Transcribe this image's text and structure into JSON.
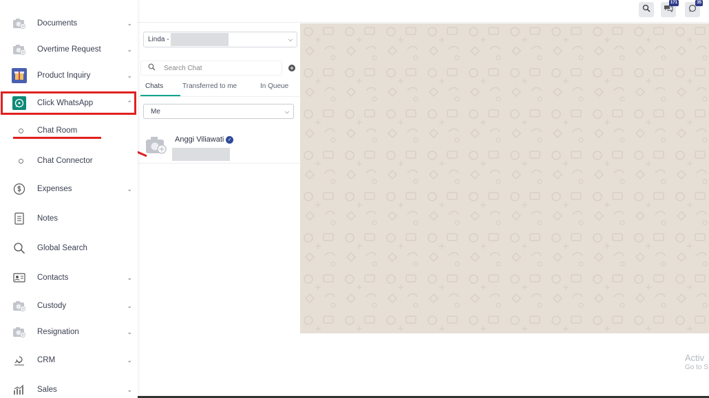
{
  "sidebar": {
    "items": [
      {
        "label": "Documents",
        "icon": "camera-placeholder-icon",
        "chevron": "down"
      },
      {
        "label": "Overtime Request",
        "icon": "camera-placeholder-icon",
        "chevron": "down"
      },
      {
        "label": "Product Inquiry",
        "icon": "product-inquiry-icon",
        "chevron": "down"
      },
      {
        "label": "Click WhatsApp",
        "icon": "whatsapp-icon",
        "chevron": "up"
      },
      {
        "label": "Chat Room",
        "icon": "circle-bullet-icon"
      },
      {
        "label": "Chat Connector",
        "icon": "circle-bullet-icon"
      },
      {
        "label": "Expenses",
        "icon": "money-icon",
        "chevron": "down"
      },
      {
        "label": "Notes",
        "icon": "notes-icon"
      },
      {
        "label": "Global Search",
        "icon": "search-icon"
      },
      {
        "label": "Contacts",
        "icon": "contacts-card-icon",
        "chevron": "down"
      },
      {
        "label": "Custody",
        "icon": "camera-placeholder-icon",
        "chevron": "down"
      },
      {
        "label": "Resignation",
        "icon": "camera-placeholder-icon",
        "chevron": "down"
      },
      {
        "label": "CRM",
        "icon": "crm-icon",
        "chevron": "down"
      },
      {
        "label": "Sales",
        "icon": "sales-chart-icon",
        "chevron": "down"
      }
    ]
  },
  "topbar": {
    "chat_badge": "171",
    "whatsapp_badge": "35"
  },
  "chat": {
    "agent_value": "Linda -",
    "search_placeholder": "Search Chat",
    "tabs": [
      "Chats",
      "Transferred to me",
      "In Queue"
    ],
    "filter_value": "Me",
    "contact_name": "Anggi Viliawati"
  },
  "watermark": {
    "line1": "Activ",
    "line2": "Go to S"
  },
  "colors": {
    "highlight": "#e02020",
    "whatsapp_green": "#0f8a76",
    "tab_active": "#0fa58c",
    "badge": "#2e3a8c",
    "wallpaper": "#e6dfd6"
  }
}
